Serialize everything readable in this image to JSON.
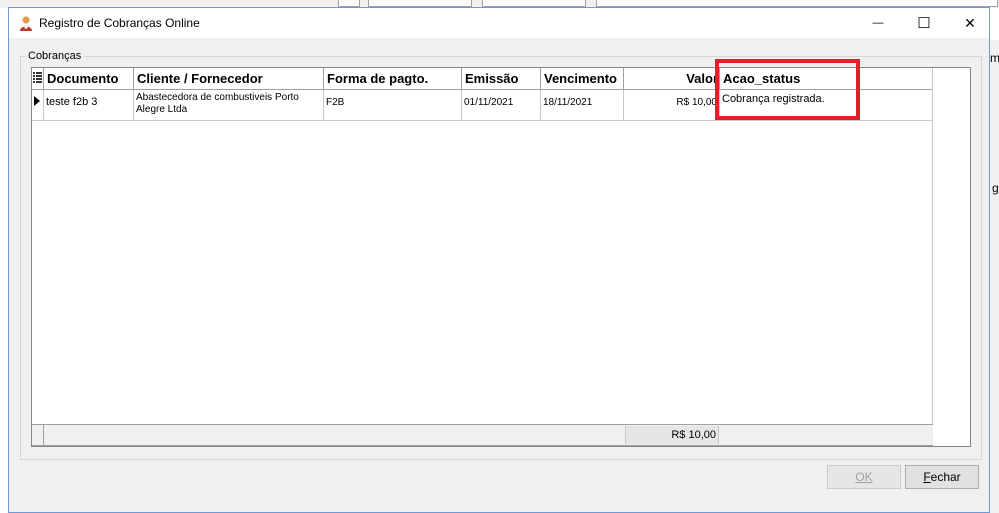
{
  "window": {
    "title": "Registro de Cobranças Online",
    "minimize_glyph": "—",
    "maximize_glyph": "☐",
    "close_glyph": "✕"
  },
  "group": {
    "label": "Cobranças"
  },
  "grid": {
    "columns": [
      "Documento",
      "Cliente / Fornecedor",
      "Forma de pagto.",
      "Emissão",
      "Vencimento",
      "Valor",
      "Acao_status"
    ],
    "rows": [
      {
        "documento": "teste f2b 3",
        "cliente_line1": "Abastecedora de combustiveis Porto",
        "cliente_line2": "Alegre Ltda",
        "forma": "F2B",
        "emissao": "01/11/2021",
        "vencimento": "18/11/2021",
        "valor": "R$ 10,00",
        "acao_status": "Cobrança registrada."
      }
    ],
    "total": "R$ 10,00"
  },
  "buttons": {
    "ok": "OK",
    "fechar_underlined": "F",
    "fechar_rest": "echar"
  },
  "background": {
    "frag_m": "m",
    "frag_g": "g"
  },
  "colors": {
    "highlight": "#e0202a",
    "window_border": "#6f9ad8"
  }
}
